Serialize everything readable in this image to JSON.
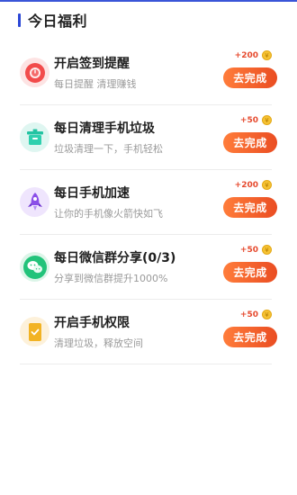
{
  "header": {
    "title": "今日福利"
  },
  "tasks": [
    {
      "title": "开启签到提醒",
      "subtitle": "每日提醒 清理赚钱",
      "reward": "+200",
      "button": "去完成",
      "icon": "alarm-icon",
      "icon_color": "#f04a4a"
    },
    {
      "title": "每日清理手机垃圾",
      "subtitle": "垃圾清理一下，手机轻松",
      "reward": "+50",
      "button": "去完成",
      "icon": "trash-icon",
      "icon_color": "#26c6a6"
    },
    {
      "title": "每日手机加速",
      "subtitle": "让你的手机像火箭快如飞",
      "reward": "+200",
      "button": "去完成",
      "icon": "rocket-icon",
      "icon_color": "#8a4ee8"
    },
    {
      "title": "每日微信群分享(0/3)",
      "subtitle": "分享到微信群提升1000%",
      "reward": "+50",
      "button": "去完成",
      "icon": "wechat-icon",
      "icon_color": "#22c37a"
    },
    {
      "title": "开启手机权限",
      "subtitle": "清理垃圾，释放空间",
      "reward": "+50",
      "button": "去完成",
      "icon": "permission-check-icon",
      "icon_color": "#f2b324"
    }
  ],
  "colors": {
    "accent": "#2b47d6",
    "button": "#f2602c",
    "reward": "#e64a2e"
  }
}
